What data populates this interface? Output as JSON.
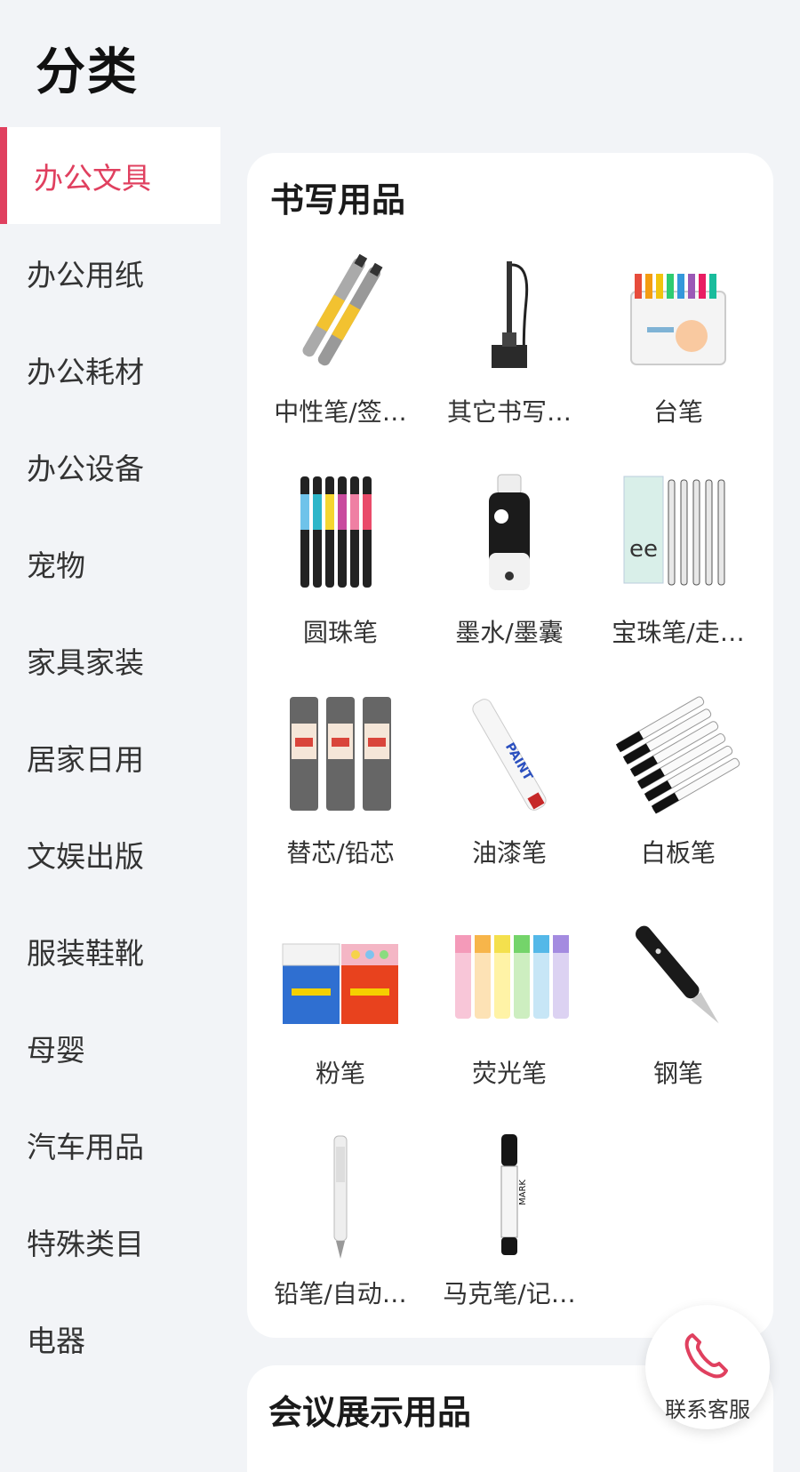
{
  "page": {
    "title": "分类"
  },
  "sidebar": {
    "items": [
      {
        "label": "办公文具",
        "active": true
      },
      {
        "label": "办公用纸"
      },
      {
        "label": "办公耗材"
      },
      {
        "label": "办公设备"
      },
      {
        "label": "宠物"
      },
      {
        "label": "家具家装"
      },
      {
        "label": "居家日用"
      },
      {
        "label": "文娱出版"
      },
      {
        "label": "服装鞋靴"
      },
      {
        "label": "母婴"
      },
      {
        "label": "汽车用品"
      },
      {
        "label": "特殊类目"
      },
      {
        "label": "电器"
      }
    ]
  },
  "section": {
    "title": "书写用品",
    "items": [
      {
        "label": "中性笔/签…",
        "icon": "gel-pen-icon"
      },
      {
        "label": "其它书写…",
        "icon": "desk-pen-icon"
      },
      {
        "label": "台笔",
        "icon": "marker-set-icon"
      },
      {
        "label": "圆珠笔",
        "icon": "ballpoint-pens-icon"
      },
      {
        "label": "墨水/墨囊",
        "icon": "ink-bottle-icon"
      },
      {
        "label": "宝珠笔/走…",
        "icon": "rollerball-pens-icon"
      },
      {
        "label": "替芯/铅芯",
        "icon": "pencil-leads-icon"
      },
      {
        "label": "油漆笔",
        "icon": "paint-marker-icon"
      },
      {
        "label": "白板笔",
        "icon": "whiteboard-markers-icon"
      },
      {
        "label": "粉笔",
        "icon": "chalk-box-icon"
      },
      {
        "label": "荧光笔",
        "icon": "highlighters-icon"
      },
      {
        "label": "钢笔",
        "icon": "fountain-pen-icon"
      },
      {
        "label": "铅笔/自动…",
        "icon": "mechanical-pencil-icon"
      },
      {
        "label": "马克笔/记…",
        "icon": "marker-pen-icon"
      }
    ]
  },
  "next_section": {
    "title": "会议展示用品"
  },
  "service": {
    "label": "联系客服",
    "icon": "phone-icon"
  },
  "colors": {
    "accent": "#e0405f",
    "background": "#f2f4f7"
  }
}
